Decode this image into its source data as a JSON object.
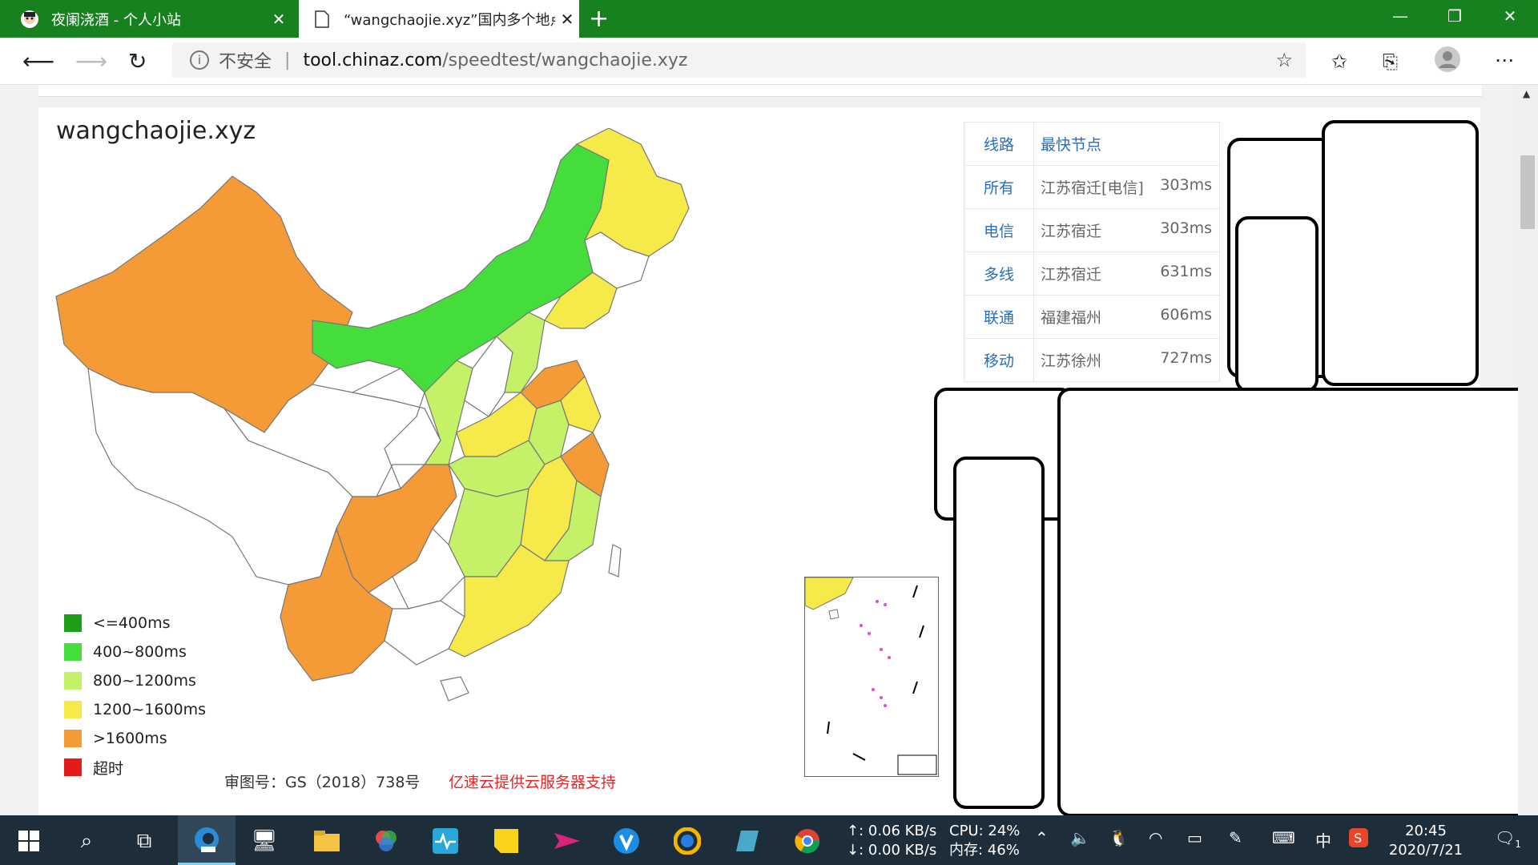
{
  "browser": {
    "tabs": [
      {
        "title": "夜阑浇酒 - 个人小站",
        "active": false
      },
      {
        "title": "“wangchaojie.xyz”国内多个地点网站测速",
        "active": true
      }
    ],
    "address": {
      "security": "不安全",
      "host": "tool.chinaz.com",
      "path": "/speedtest/wangchaojie.xyz"
    }
  },
  "page": {
    "domain": "wangchaojie.xyz",
    "table": {
      "headers": [
        "线路",
        "最快节点"
      ],
      "rows": [
        {
          "line": "所有",
          "node": "江苏宿迁[电信]",
          "time": "303ms"
        },
        {
          "line": "电信",
          "node": "江苏宿迁",
          "time": "303ms"
        },
        {
          "line": "多线",
          "node": "江苏宿迁",
          "time": "631ms"
        },
        {
          "line": "联通",
          "node": "福建福州",
          "time": "606ms"
        },
        {
          "line": "移动",
          "node": "江苏徐州",
          "time": "727ms"
        }
      ]
    },
    "legend": [
      {
        "label": "<=400ms",
        "color": "#1f9e1b"
      },
      {
        "label": "400~800ms",
        "color": "#44dd3c"
      },
      {
        "label": "800~1200ms",
        "color": "#c5f168"
      },
      {
        "label": "1200~1600ms",
        "color": "#f6e94a"
      },
      {
        "label": ">1600ms",
        "color": "#f49a36"
      },
      {
        "label": "超时",
        "color": "#e31b1b"
      }
    ],
    "footer_review": "审图号：GS（2018）738号",
    "footer_sponsor": "亿速云提供云服务器支持"
  },
  "taskbar": {
    "net_up": "↑: 0.06 KB/s",
    "net_down": "↓: 0.00 KB/s",
    "cpu": "CPU: 24%",
    "mem": "内存: 46%",
    "ime": "中",
    "time": "20:45",
    "date": "2020/7/21",
    "notifications": "1"
  }
}
